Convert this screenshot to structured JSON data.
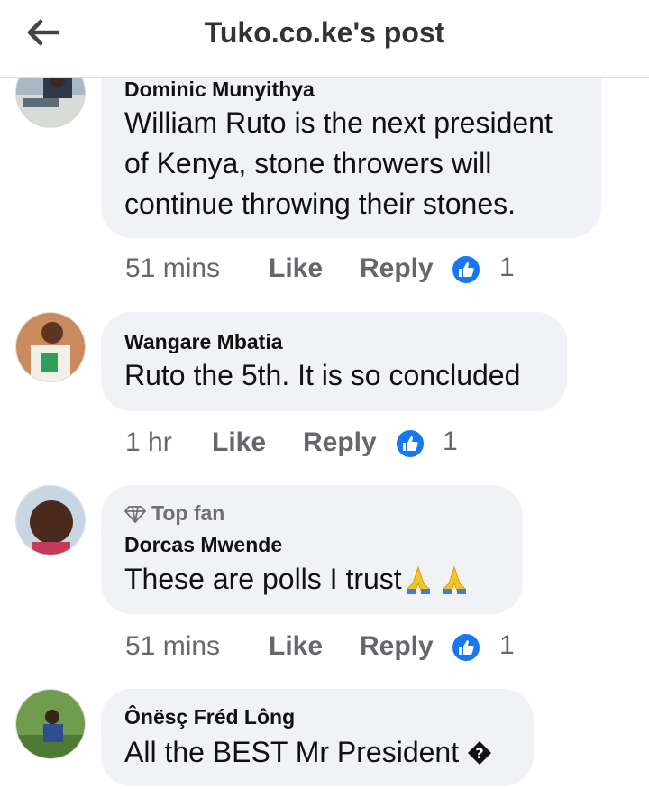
{
  "header": {
    "title": "Tuko.co.ke's post",
    "back_icon": "arrow-left-icon"
  },
  "comments": [
    {
      "author": "Dominic Munyithya",
      "text": [
        "William Ruto is the next president",
        "of Kenya, stone throwers will",
        "continue throwing their stones."
      ],
      "time": "51 mins",
      "like_label": "Like",
      "reply_label": "Reply",
      "reactions": "1"
    },
    {
      "author": "Wangare Mbatia",
      "text": [
        "Ruto the 5th. It is so concluded"
      ],
      "time": "1 hr",
      "like_label": "Like",
      "reply_label": "Reply",
      "reactions": "1"
    },
    {
      "badge": "Top fan",
      "author": "Dorcas Mwende",
      "text": [
        "These are polls I trust"
      ],
      "time": "51 mins",
      "like_label": "Like",
      "reply_label": "Reply",
      "reactions": "1"
    },
    {
      "author": "Ônësç Fréd Lông",
      "text": [
        "All the BEST Mr President"
      ]
    }
  ],
  "colors": {
    "bubble": "#f0f2f5",
    "like_blue": "#1877f2",
    "meta_gray": "#65676b"
  }
}
